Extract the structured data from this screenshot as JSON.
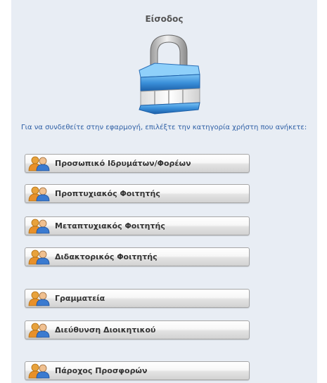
{
  "page": {
    "title": "Είσοδος",
    "intro": "Για να συνδεθείτε στην εφαρμογή, επιλέξτε την κατηγορία χρήστη που ανήκετε:"
  },
  "buttons": [
    {
      "label": "Προσωπικό Ιδρυμάτων/Φορέων",
      "icon": "users-icon"
    },
    {
      "label": "Προπτυχιακός Φοιτητής",
      "icon": "users-icon"
    },
    {
      "label": "Μεταπτυχιακός Φοιτητής",
      "icon": "users-icon"
    },
    {
      "label": "Διδακτορικός Φοιτητής",
      "icon": "users-icon"
    },
    {
      "label": "Γραμματεία",
      "icon": "users-icon"
    },
    {
      "label": "Διεύθυνση Διοικητικού",
      "icon": "users-icon"
    },
    {
      "label": "Πάροχος Προσφορών",
      "icon": "users-icon"
    }
  ],
  "colors": {
    "panel_bg": "#e8edf4",
    "intro_text": "#2e5fa5",
    "lock_blue": "#3a8fd9"
  }
}
